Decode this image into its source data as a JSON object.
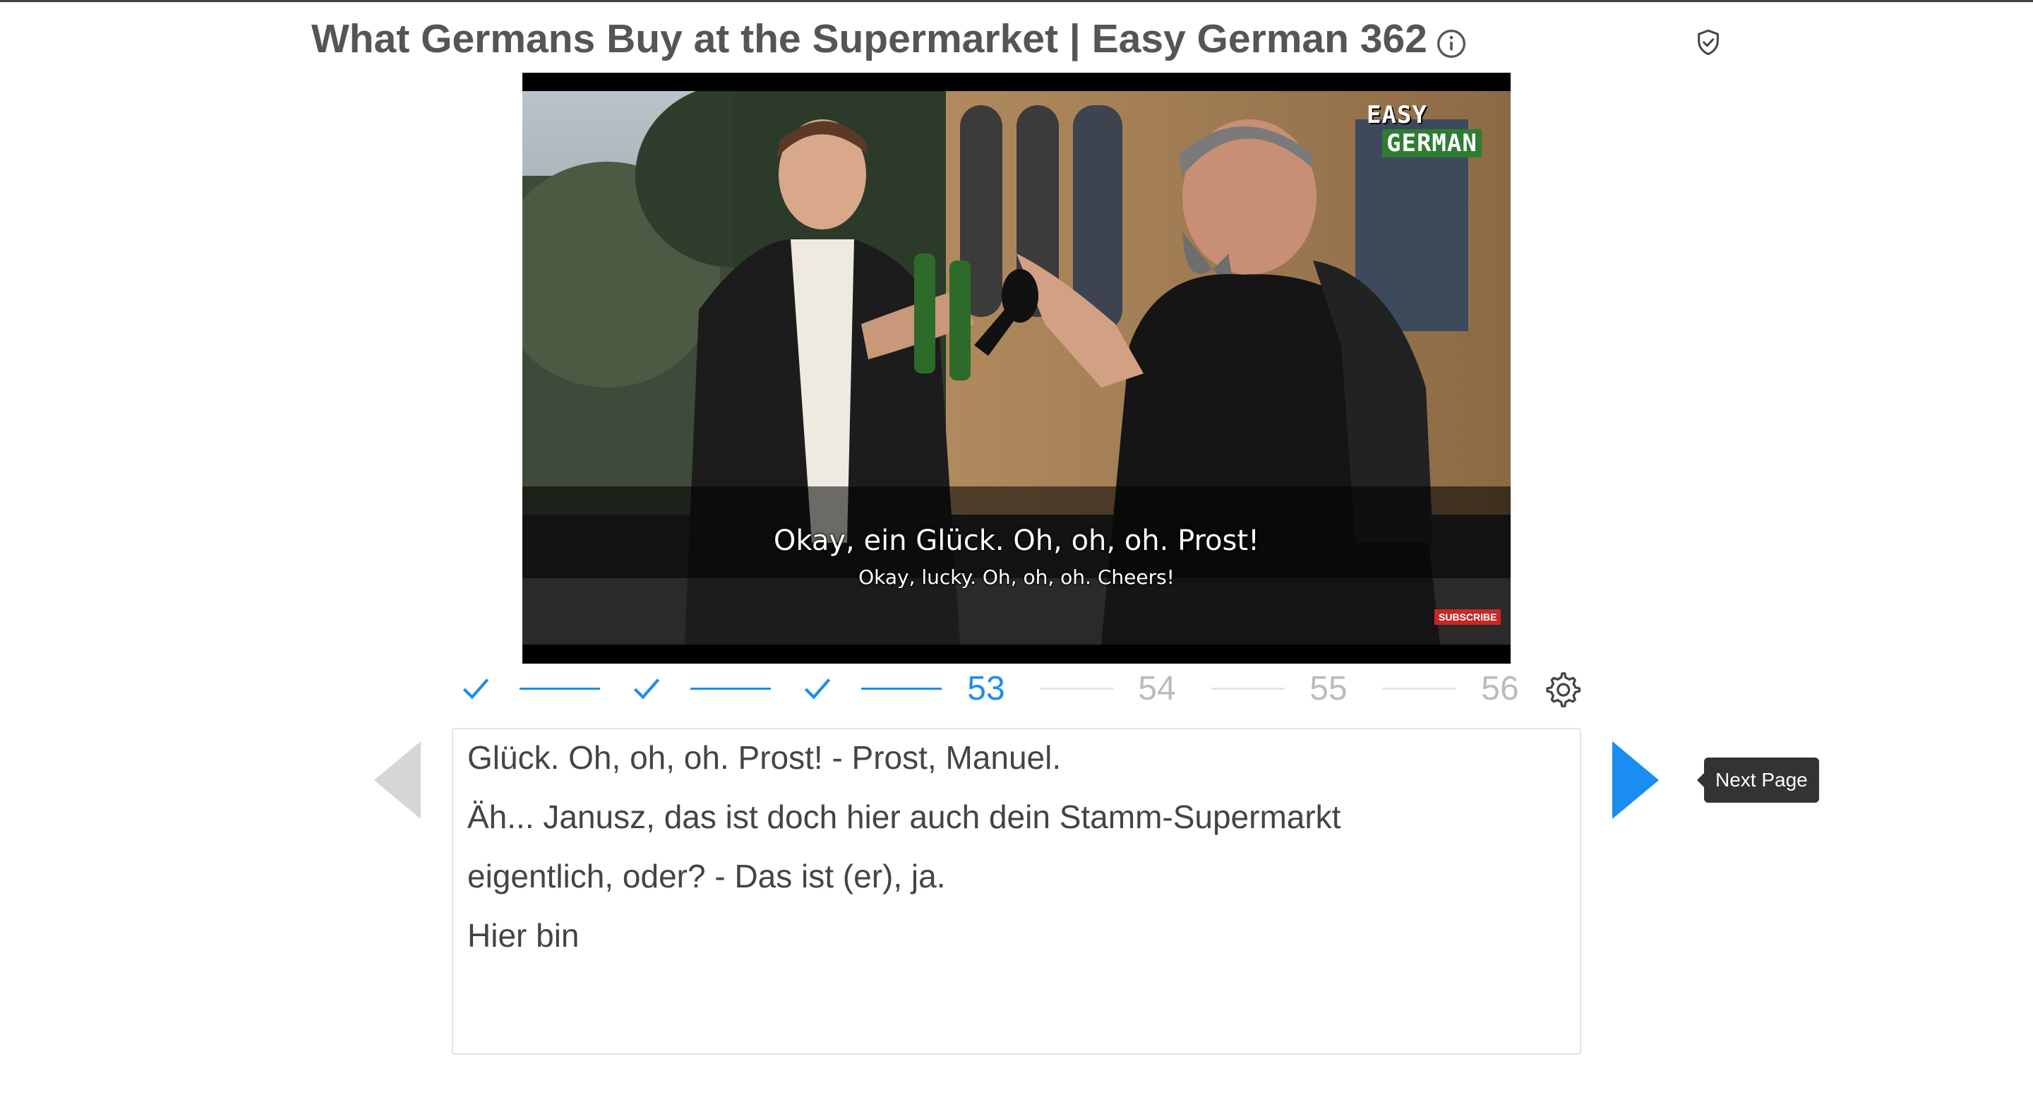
{
  "header": {
    "title": "What Germans Buy at the Supermarket | Easy German 362"
  },
  "video": {
    "subtitle_german": "Okay, ein Glück. Oh, oh, oh. Prost!",
    "subtitle_english": "Okay, lucky. Oh, oh, oh. Cheers!",
    "logo_line1": "EASY",
    "logo_line2": "GERMAN",
    "subscribe_label": "SUBSCRIBE"
  },
  "progress": {
    "completed_steps": 3,
    "current_page": "53",
    "upcoming_pages": [
      "54",
      "55",
      "56"
    ]
  },
  "transcript": {
    "lines": [
      "Glück. Oh, oh, oh. Prost! - Prost, Manuel.",
      "Äh... Janusz, das ist doch hier auch dein Stamm-Supermarkt",
      "eigentlich, oder? - Das ist (er), ja.",
      "Hier bin"
    ]
  },
  "tooltip": {
    "next_page": "Next Page"
  },
  "colors": {
    "accent": "#1a8ef0",
    "inactive": "#bbbbbb",
    "text": "#444444"
  },
  "icons": [
    "info-icon",
    "shield-check-icon",
    "checkmark-icon",
    "gear-icon",
    "previous-page-arrow-icon",
    "next-page-arrow-icon"
  ]
}
